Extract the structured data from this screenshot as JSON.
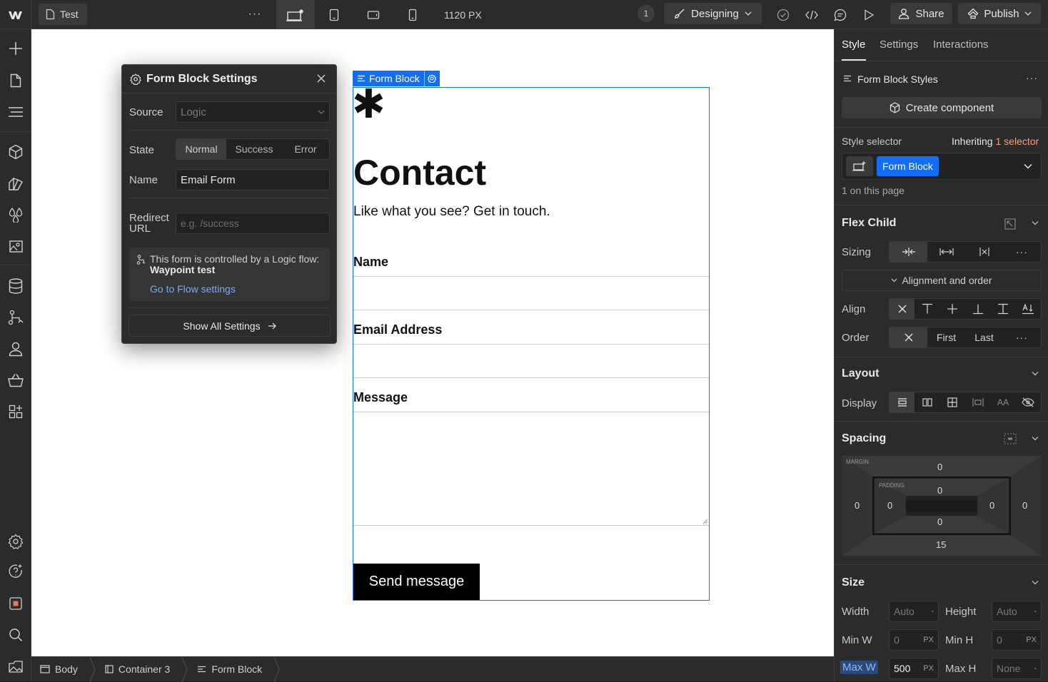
{
  "topbar": {
    "page_name": "Test",
    "more_label": "···",
    "canvas_width": "1120 PX",
    "notification_count": "1",
    "mode": "Designing",
    "share": "Share",
    "publish": "Publish"
  },
  "popover": {
    "title": "Form Block Settings",
    "source_label": "Source",
    "source_value": "Logic",
    "state_label": "State",
    "states": [
      "Normal",
      "Success",
      "Error"
    ],
    "name_label": "Name",
    "name_value": "Email Form",
    "redirect_label_1": "Redirect",
    "redirect_label_2": "URL",
    "redirect_placeholder": "e.g. /success",
    "info_text": "This form is controlled by a Logic flow: ",
    "info_flow": "Waypoint test",
    "flow_link": "Go to Flow settings",
    "show_all": "Show All Settings"
  },
  "canvas": {
    "selection_label": "Form Block",
    "asterisk": "✱",
    "heading": "Contact",
    "subheading": "Like what you see? Get in touch.",
    "field_name_label": "Name",
    "field_email_label": "Email Address",
    "field_message_label": "Message",
    "submit": "Send message"
  },
  "breadcrumb": {
    "items": [
      "Body",
      "Container 3",
      "Form Block"
    ]
  },
  "panel": {
    "tabs": [
      "Style",
      "Settings",
      "Interactions"
    ],
    "styles_title": "Form Block Styles",
    "create_component": "Create component",
    "style_selector": "Style selector",
    "inheriting": "Inheriting ",
    "inheriting_count": "1 selector",
    "selector_chip": "Form Block",
    "on_page": "1 on this page",
    "flex_child": "Flex Child",
    "sizing": "Sizing",
    "alignment_order": "Alignment and order",
    "align": "Align",
    "order": "Order",
    "order_first": "First",
    "order_last": "Last",
    "layout": "Layout",
    "display": "Display",
    "spacing": "Spacing",
    "margin_label": "MARGIN",
    "padding_label": "PADDING",
    "margin_top": "0",
    "margin_left": "0",
    "margin_right": "0",
    "margin_bottom": "15",
    "padding_top": "0",
    "padding_left": "0",
    "padding_right": "0",
    "padding_bottom": "0",
    "size": "Size",
    "width": "Width",
    "height": "Height",
    "width_value": "Auto",
    "height_value": "Auto",
    "min_w": "Min W",
    "min_h": "Min H",
    "min_w_value": "0",
    "min_h_value": "0",
    "max_w": "Max W",
    "max_h": "Max H",
    "max_w_value": "500",
    "max_h_value": "None",
    "unit_px": "PX",
    "unit_dash": "-"
  },
  "colors": {
    "accent_blue": "#146ef5",
    "inherit_orange": "#f0a07a",
    "link_blue": "#78a9f7"
  }
}
